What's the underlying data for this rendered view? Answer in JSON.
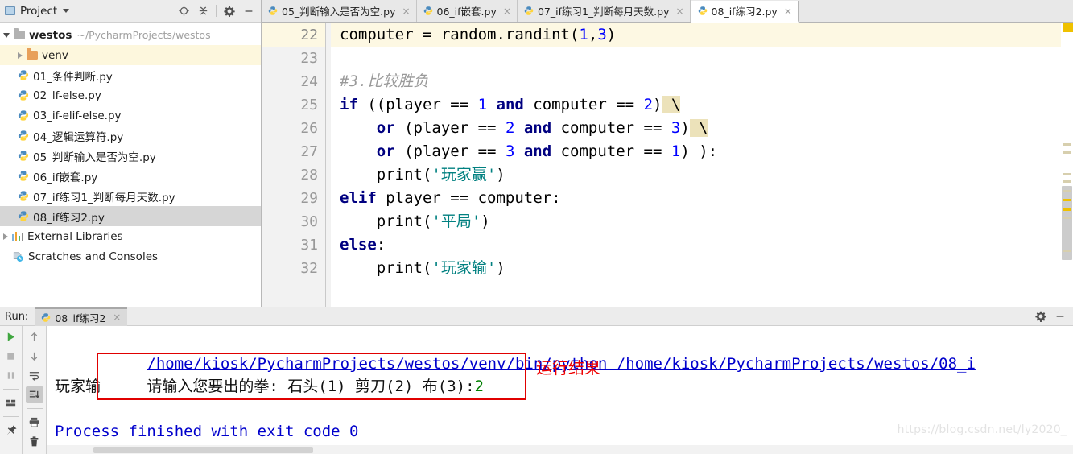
{
  "project_panel": {
    "title": "Project",
    "icons": [
      "project-window-icon",
      "locate-target-icon",
      "collapse-all-icon",
      "settings-gear-icon",
      "minimize-icon"
    ],
    "tree": [
      {
        "label": "westos",
        "path": "~/PycharmProjects/westos",
        "type": "root-folder",
        "expanded": true,
        "depth": 0,
        "selected": false
      },
      {
        "label": "venv",
        "path": "",
        "type": "folder",
        "expanded": false,
        "depth": 1,
        "selected": false,
        "highlight": "venv"
      },
      {
        "label": "01_条件判断.py",
        "path": "",
        "type": "python-file",
        "depth": 2,
        "selected": false
      },
      {
        "label": "02_lf-else.py",
        "path": "",
        "type": "python-file",
        "depth": 2,
        "selected": false
      },
      {
        "label": "03_if-elif-else.py",
        "path": "",
        "type": "python-file",
        "depth": 2,
        "selected": false
      },
      {
        "label": "04_逻辑运算符.py",
        "path": "",
        "type": "python-file",
        "depth": 2,
        "selected": false
      },
      {
        "label": "05_判断输入是否为空.py",
        "path": "",
        "type": "python-file",
        "depth": 2,
        "selected": false
      },
      {
        "label": "06_if嵌套.py",
        "path": "",
        "type": "python-file",
        "depth": 2,
        "selected": false
      },
      {
        "label": "07_if练习1_判断每月天数.py",
        "path": "",
        "type": "python-file",
        "depth": 2,
        "selected": false
      },
      {
        "label": "08_if练习2.py",
        "path": "",
        "type": "python-file",
        "depth": 2,
        "selected": true
      },
      {
        "label": "External Libraries",
        "path": "",
        "type": "libraries",
        "expanded": false,
        "depth": 0,
        "selected": false
      },
      {
        "label": "Scratches and Consoles",
        "path": "",
        "type": "scratches",
        "depth": 0,
        "selected": false
      }
    ]
  },
  "editor": {
    "tabs": [
      {
        "label": "05_判断输入是否为空.py",
        "active": false
      },
      {
        "label": "06_if嵌套.py",
        "active": false
      },
      {
        "label": "07_if练习1_判断每月天数.py",
        "active": false
      },
      {
        "label": "08_if练习2.py",
        "active": true
      }
    ],
    "close_glyph": "×",
    "first_line_number": 22,
    "lines": [
      {
        "n": 22,
        "current": true,
        "tokens": [
          {
            "t": "computer = random.randint(",
            "c": "fn"
          },
          {
            "t": "1",
            "c": "num"
          },
          {
            "t": ",",
            "c": "fn"
          },
          {
            "t": "3",
            "c": "num"
          },
          {
            "t": ")",
            "c": "fn"
          }
        ]
      },
      {
        "n": 23,
        "current": false,
        "tokens": []
      },
      {
        "n": 24,
        "current": false,
        "tokens": [
          {
            "t": "#3.比较胜负",
            "c": "cmt"
          }
        ]
      },
      {
        "n": 25,
        "current": false,
        "tokens": [
          {
            "t": "if",
            "c": "kw"
          },
          {
            "t": " ((player == ",
            "c": "fn"
          },
          {
            "t": "1",
            "c": "num"
          },
          {
            "t": " ",
            "c": "fn"
          },
          {
            "t": "and",
            "c": "kw"
          },
          {
            "t": " computer == ",
            "c": "fn"
          },
          {
            "t": "2",
            "c": "num"
          },
          {
            "t": ")",
            "c": "fn"
          },
          {
            "t": " \\",
            "c": "bslash"
          }
        ]
      },
      {
        "n": 26,
        "current": false,
        "tokens": [
          {
            "t": "    ",
            "c": "fn"
          },
          {
            "t": "or",
            "c": "kw"
          },
          {
            "t": " (player == ",
            "c": "fn"
          },
          {
            "t": "2",
            "c": "num"
          },
          {
            "t": " ",
            "c": "fn"
          },
          {
            "t": "and",
            "c": "kw"
          },
          {
            "t": " computer == ",
            "c": "fn"
          },
          {
            "t": "3",
            "c": "num"
          },
          {
            "t": ")",
            "c": "fn"
          },
          {
            "t": " \\",
            "c": "bslash"
          }
        ]
      },
      {
        "n": 27,
        "current": false,
        "tokens": [
          {
            "t": "    ",
            "c": "fn"
          },
          {
            "t": "or",
            "c": "kw"
          },
          {
            "t": " (player == ",
            "c": "fn"
          },
          {
            "t": "3",
            "c": "num"
          },
          {
            "t": " ",
            "c": "fn"
          },
          {
            "t": "and",
            "c": "kw"
          },
          {
            "t": " computer == ",
            "c": "fn"
          },
          {
            "t": "1",
            "c": "num"
          },
          {
            "t": ") ):",
            "c": "fn"
          }
        ]
      },
      {
        "n": 28,
        "current": false,
        "tokens": [
          {
            "t": "    print(",
            "c": "fn"
          },
          {
            "t": "'玩家赢'",
            "c": "str"
          },
          {
            "t": ")",
            "c": "fn"
          }
        ]
      },
      {
        "n": 29,
        "current": false,
        "tokens": [
          {
            "t": "elif",
            "c": "kw"
          },
          {
            "t": " player == computer:",
            "c": "fn"
          }
        ]
      },
      {
        "n": 30,
        "current": false,
        "tokens": [
          {
            "t": "    print(",
            "c": "fn"
          },
          {
            "t": "'平局'",
            "c": "str"
          },
          {
            "t": ")",
            "c": "fn"
          }
        ]
      },
      {
        "n": 31,
        "current": false,
        "tokens": [
          {
            "t": "else",
            "c": "kw"
          },
          {
            "t": ":",
            "c": "fn"
          }
        ]
      },
      {
        "n": 32,
        "current": false,
        "tokens": [
          {
            "t": "    print(",
            "c": "fn"
          },
          {
            "t": "'玩家输'",
            "c": "str"
          },
          {
            "t": ")",
            "c": "fn"
          }
        ]
      }
    ]
  },
  "run_panel": {
    "label": "Run:",
    "tab_label": "08_if练习2",
    "close_glyph": "×",
    "tools_left": [
      "run-icon",
      "stop-icon",
      "pause-icon",
      "layout-icon",
      "pin-icon"
    ],
    "tools_right": [
      "scroll-up-icon",
      "scroll-down-icon",
      "soft-wrap-icon",
      "scroll-to-end-icon",
      "print-icon",
      "trash-icon"
    ],
    "header_icons": [
      "settings-gear-icon",
      "minimize-icon"
    ],
    "console": {
      "command_line": "/home/kiosk/PycharmProjects/westos/venv/bin/python /home/kiosk/PycharmProjects/westos/08_i",
      "prompt_text": "请输入您要出的拳: 石头(1) 剪刀(2) 布(3):",
      "user_input": "2",
      "result_text": "玩家输",
      "exit_line": "Process finished with exit code 0"
    },
    "annotation": "运行结果"
  },
  "watermark": "https://blog.csdn.net/ly2020_",
  "colors": {
    "keyword": "#000080",
    "number": "#0000ff",
    "string": "#008080",
    "comment": "#9a9a9a",
    "console_link": "#0000cc",
    "console_input": "#008000",
    "annotation_red": "#ee0000",
    "caret_line": "#fdf8e3",
    "selection_gray": "#d6d6d6"
  }
}
